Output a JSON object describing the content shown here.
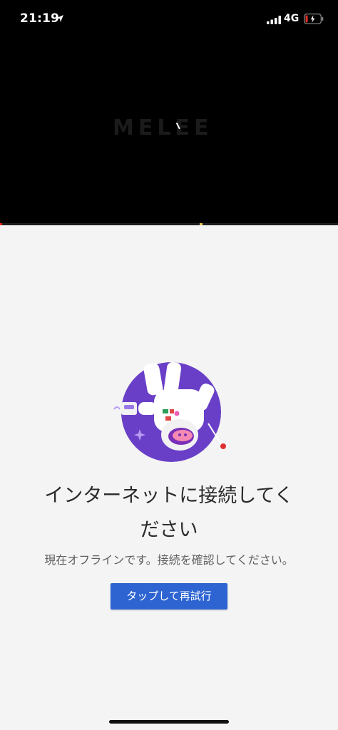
{
  "status_bar": {
    "time": "21:19",
    "network": "4G"
  },
  "video": {
    "logo_text": "MELEE",
    "progress_played_fraction": 0.007,
    "progress_marker_fraction": 0.59
  },
  "offline": {
    "title_line1": "インターネットに接続してく",
    "title_line2": "ださい",
    "message": "現在オフラインです。接続を確認してください。",
    "retry_button_label": "タップして再試行"
  },
  "colors": {
    "accent_button": "#2d64d2",
    "progress_red": "#e62117",
    "illustration_circle": "#6a3fc8"
  },
  "icons": {
    "location": "location-arrow-icon",
    "signal": "cellular-signal-icon",
    "battery": "battery-charging-icon",
    "spinner": "loading-spinner-icon"
  }
}
